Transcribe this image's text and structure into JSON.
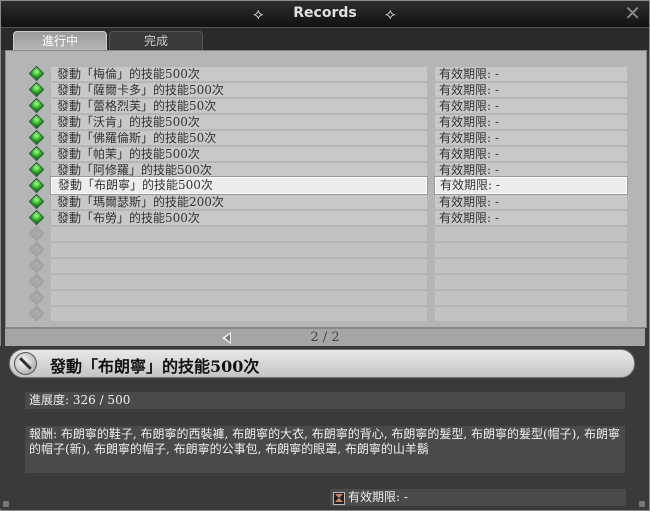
{
  "window": {
    "title": "Records",
    "close_glyph": "✕"
  },
  "tabs": [
    {
      "label": "進行中",
      "active": true
    },
    {
      "label": "完成",
      "active": false
    }
  ],
  "records": [
    {
      "name": "發動「梅倫」的技能500次",
      "expiry": "有效期限: -"
    },
    {
      "name": "發動「薩爾卡多」的技能500次",
      "expiry": "有效期限: -"
    },
    {
      "name": "發動「蕾格烈芙」的技能50次",
      "expiry": "有效期限: -"
    },
    {
      "name": "發動「沃肯」的技能500次",
      "expiry": "有效期限: -"
    },
    {
      "name": "發動「佛羅倫斯」的技能50次",
      "expiry": "有效期限: -"
    },
    {
      "name": "發動「帕茉」的技能500次",
      "expiry": "有效期限: -"
    },
    {
      "name": "發動「阿修羅」的技能500次",
      "expiry": "有效期限: -"
    },
    {
      "name": "發動「布朗寧」的技能500次",
      "expiry": "有效期限: -"
    },
    {
      "name": "發動「瑪爾瑟斯」的技能200次",
      "expiry": "有效期限: -"
    },
    {
      "name": "發動「布勞」的技能500次",
      "expiry": "有效期限: -"
    }
  ],
  "selected_index": 7,
  "pager": {
    "text": "2 / 2"
  },
  "detail": {
    "title": "發動「布朗寧」的技能500次",
    "progress": "進展度: 326 / 500",
    "progress_current": 326,
    "progress_total": 500,
    "reward": "報酬: 布朗寧的鞋子, 布朗寧的西裝褲, 布朗寧的大衣, 布朗寧的背心, 布朗寧的髮型, 布朗寧的髮型(帽子), 布朗寧的帽子(新), 布朗寧的帽子, 布朗寧的公事包, 布朗寧的眼罩, 布朗寧的山羊鬍",
    "expiry": "有效期限: -"
  },
  "icons": {
    "gem": "green-diamond-icon",
    "detail": "feather-quill-icon",
    "expiry": "hourglass-icon"
  },
  "colors": {
    "gem_active": "#1c9a1c",
    "panel_bg": "#b5b5b5"
  }
}
